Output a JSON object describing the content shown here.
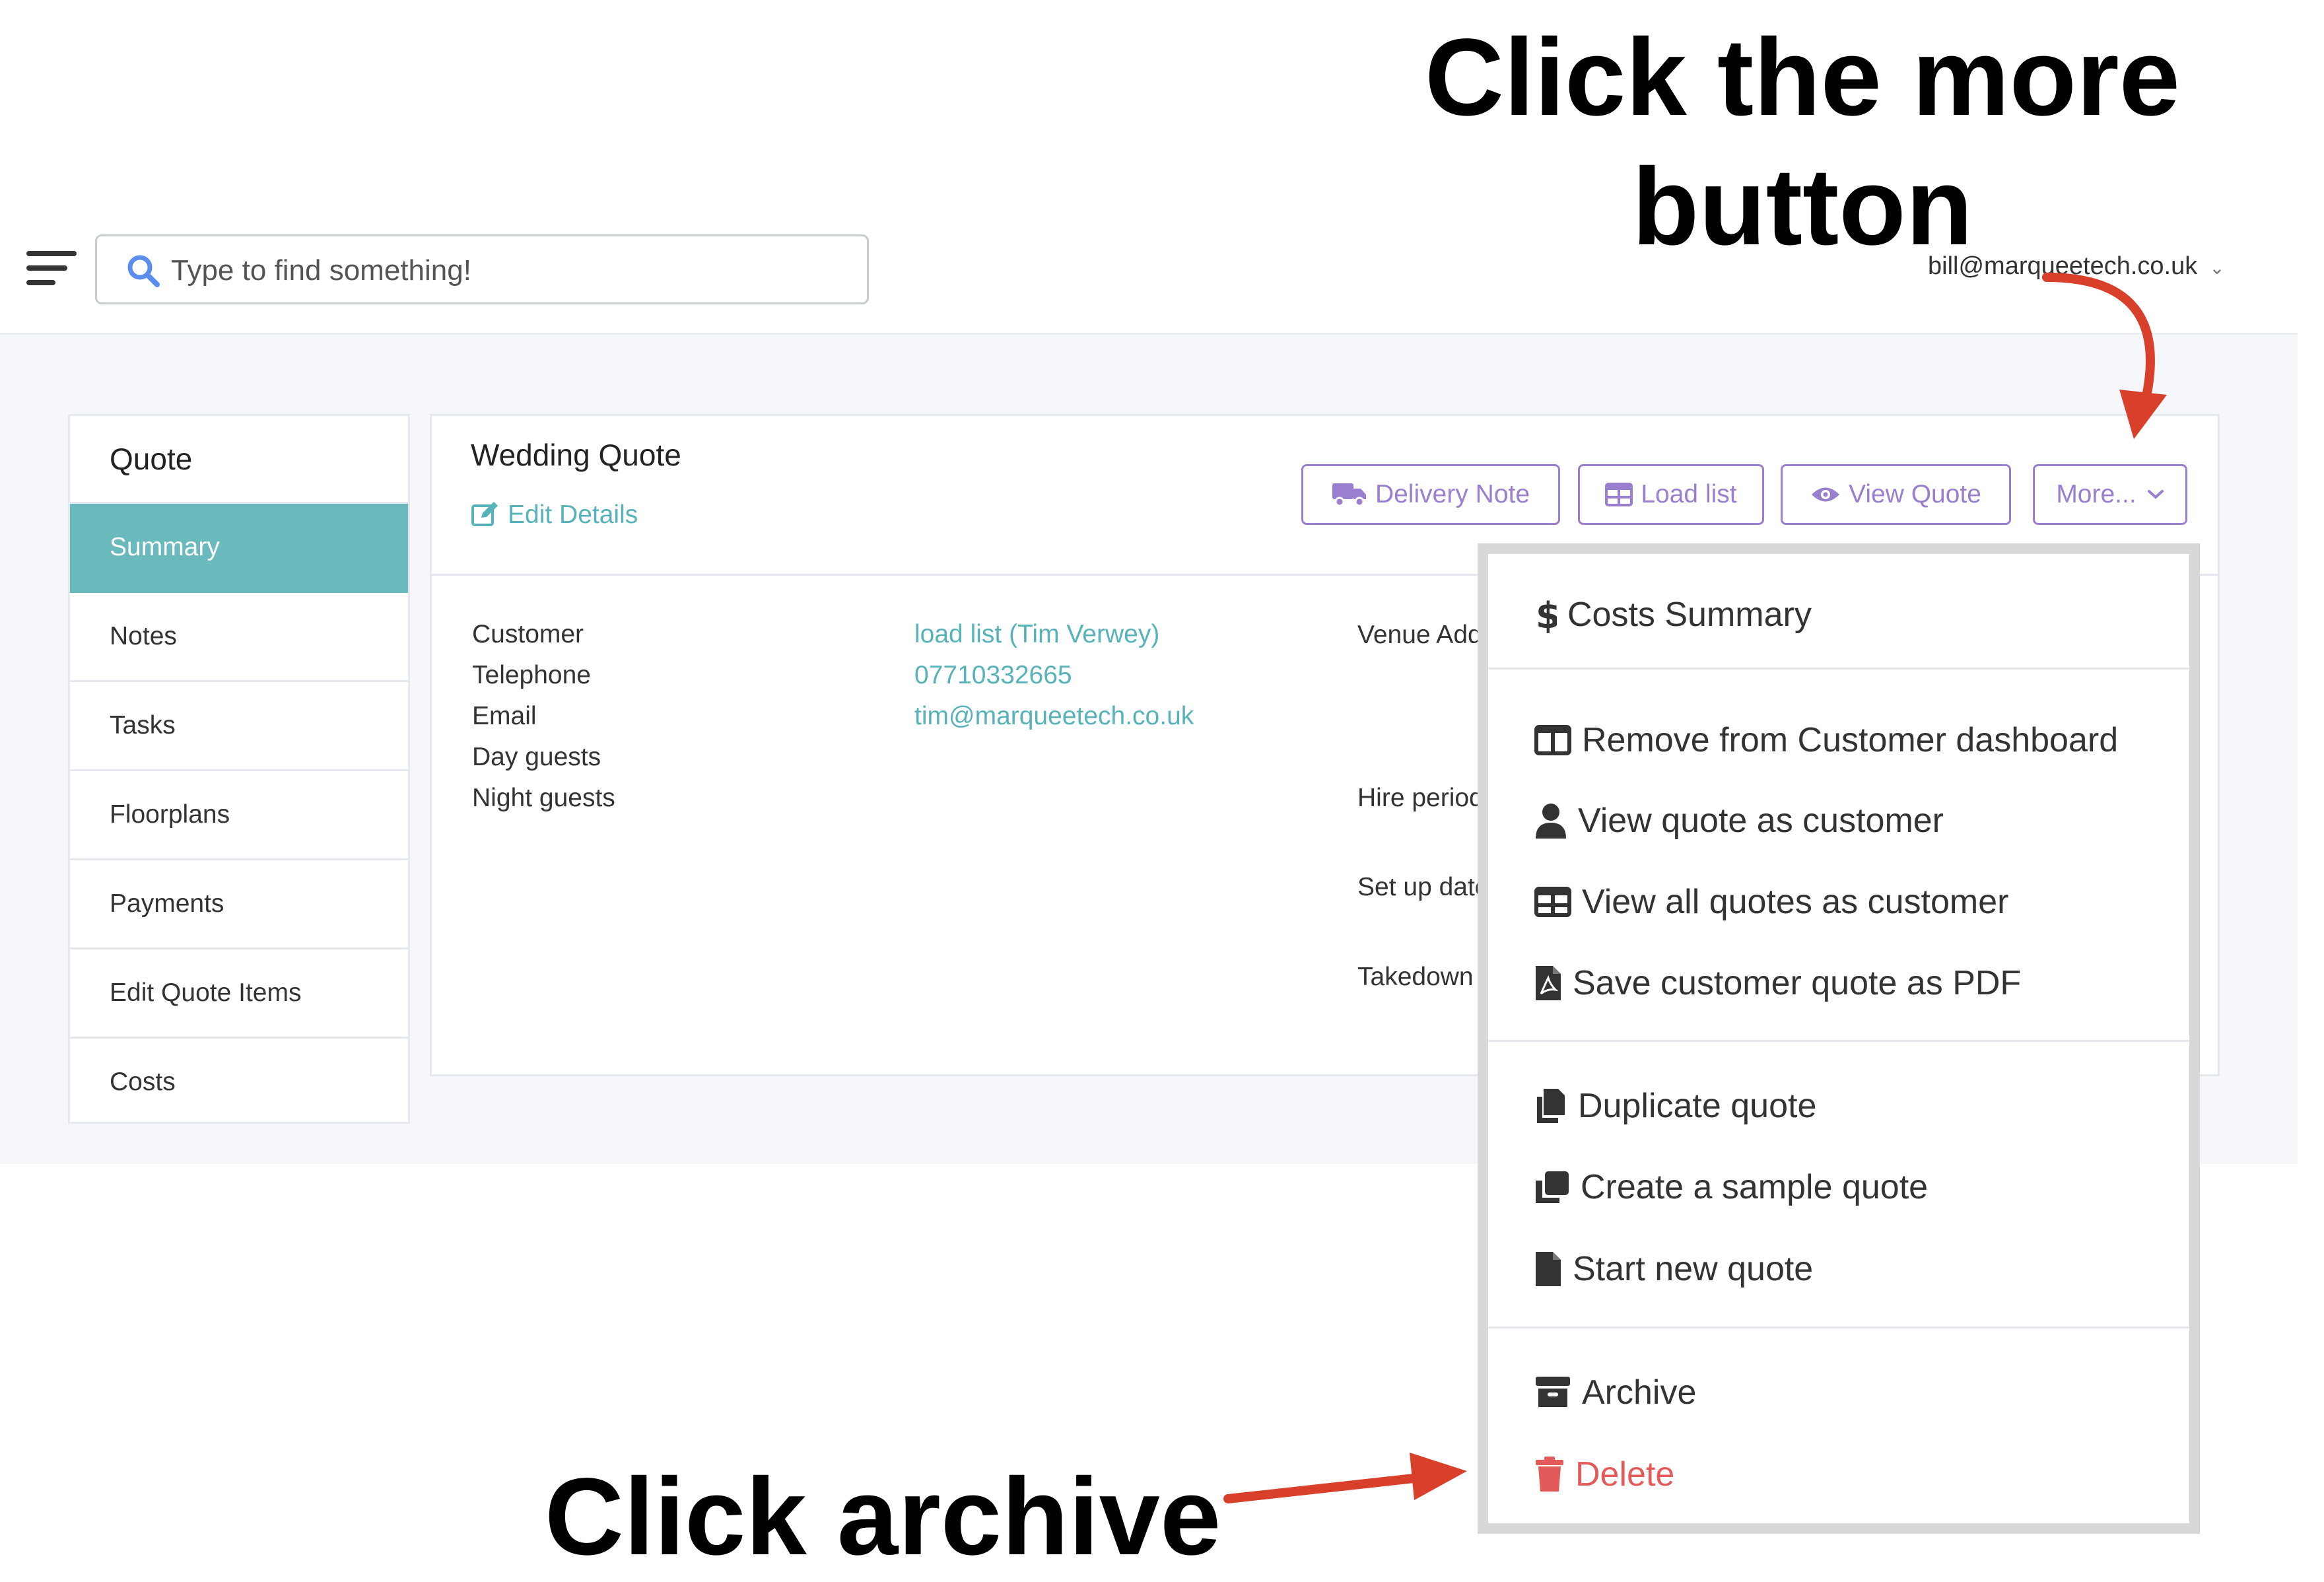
{
  "header": {
    "menu_icon": "hamburger-menu-icon",
    "search": {
      "placeholder": "Type to find something!",
      "icon": "search-icon"
    },
    "user": {
      "email": "bill@marqueetech.co.uk",
      "icon": "chevron-down-icon"
    }
  },
  "sidebar": {
    "title": "Quote",
    "items": [
      {
        "label": "Summary",
        "active": true
      },
      {
        "label": "Notes",
        "active": false
      },
      {
        "label": "Tasks",
        "active": false
      },
      {
        "label": "Floorplans",
        "active": false
      },
      {
        "label": "Payments",
        "active": false
      },
      {
        "label": "Edit Quote Items",
        "active": false
      },
      {
        "label": "Costs",
        "active": false
      }
    ]
  },
  "quote": {
    "title": "Wedding Quote",
    "edit_details": "Edit Details",
    "buttons": {
      "delivery_note": "Delivery Note",
      "load_list": "Load list",
      "view_quote": "View Quote",
      "more": "More..."
    },
    "fields": [
      {
        "label": "Customer",
        "value": "load list (Tim Verwey)"
      },
      {
        "label": "Telephone",
        "value": "07710332665"
      },
      {
        "label": "Email",
        "value": "tim@marqueetech.co.uk"
      },
      {
        "label": "Day guests",
        "value": ""
      },
      {
        "label": "Night guests",
        "value": ""
      }
    ],
    "venue_fields": {
      "venue_address": "Venue Address",
      "hire_period": "Hire period",
      "set_up_date": "Set up date",
      "takedown": "Takedown"
    }
  },
  "more_menu": {
    "costs_summary": "Costs Summary",
    "remove_dashboard": "Remove from Customer dashboard",
    "view_as_customer": "View quote as customer",
    "view_all_as_customer": "View all quotes as customer",
    "save_pdf": "Save customer quote as PDF",
    "duplicate": "Duplicate quote",
    "create_sample": "Create a sample quote",
    "start_new": "Start new quote",
    "archive": "Archive",
    "delete": "Delete"
  },
  "annotations": {
    "more_line1": "Click the more",
    "more_line2": "button",
    "archive": "Click archive"
  },
  "colors": {
    "accent_teal": "#69b9bd",
    "link_teal": "#57b3b8",
    "button_purple": "#9b7fcf",
    "danger_red": "#e25a5a",
    "annotation_arrow": "#d9402b"
  }
}
